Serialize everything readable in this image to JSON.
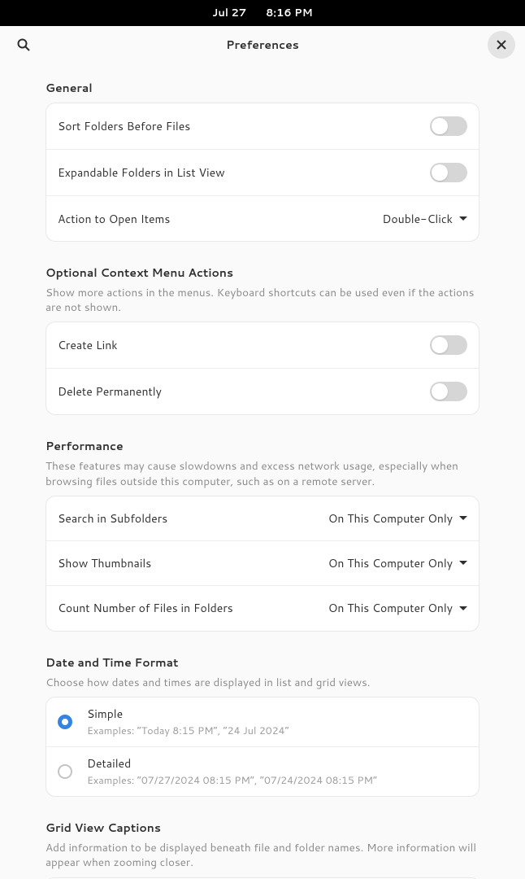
{
  "topbar": {
    "date": "Jul 27",
    "time": "8:16 PM"
  },
  "header": {
    "title": "Preferences"
  },
  "groups": {
    "general": {
      "title": "General",
      "sort_folders": "Sort Folders Before Files",
      "expandable": "Expandable Folders in List View",
      "action_open": "Action to Open Items",
      "action_open_value": "Double-Click"
    },
    "context": {
      "title": "Optional Context Menu Actions",
      "desc": "Show more actions in the menus. Keyboard shortcuts can be used even if the actions are not shown.",
      "create_link": "Create Link",
      "delete_perm": "Delete Permanently"
    },
    "performance": {
      "title": "Performance",
      "desc": "These features may cause slowdowns and excess network usage, especially when browsing files outside this computer, such as on a remote server.",
      "search_sub": "Search in Subfolders",
      "search_sub_value": "On This Computer Only",
      "thumbnails": "Show Thumbnails",
      "thumbnails_value": "On This Computer Only",
      "count_files": "Count Number of Files in Folders",
      "count_files_value": "On This Computer Only"
    },
    "datetime": {
      "title": "Date and Time Format",
      "desc": "Choose how dates and times are displayed in list and grid views.",
      "simple": "Simple",
      "simple_sub": "Examples: “Today 8:15 PM”, “24 Jul 2024”",
      "detailed": "Detailed",
      "detailed_sub": "Examples: “07/27/2024 08:15 PM”, “07/24/2024 08:15 PM”"
    },
    "grid": {
      "title": "Grid View Captions",
      "desc": "Add information to be displayed beneath file and folder names. More information will appear when zooming closer."
    }
  }
}
